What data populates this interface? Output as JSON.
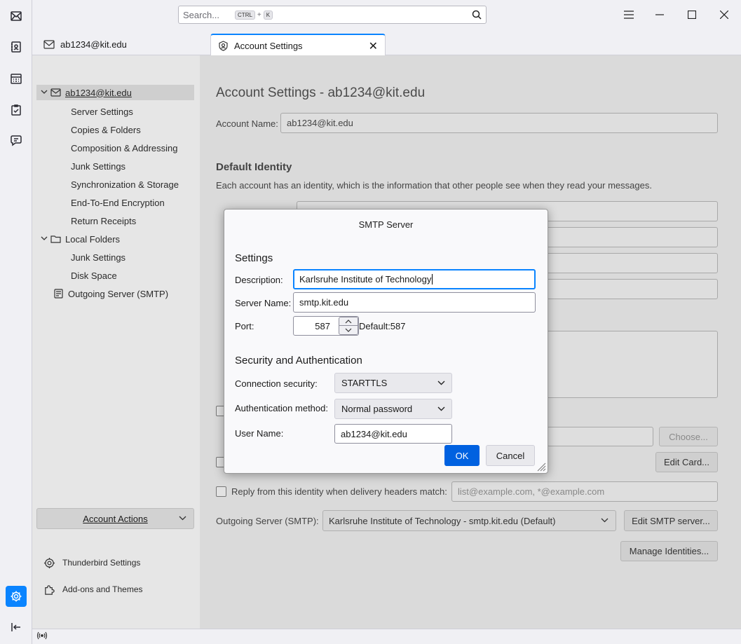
{
  "titlebar": {
    "search_placeholder": "Search...",
    "search_kbd1": "CTRL",
    "search_plus": "+",
    "search_kbd2": "K"
  },
  "tabs": [
    {
      "label": "ab1234@kit.edu"
    },
    {
      "label": "Account Settings"
    }
  ],
  "sidebar": {
    "account": "ab1234@kit.edu",
    "account_items": [
      "Server Settings",
      "Copies & Folders",
      "Composition & Addressing",
      "Junk Settings",
      "Synchronization & Storage",
      "End-To-End Encryption",
      "Return Receipts"
    ],
    "local_folders": "Local Folders",
    "local_items": [
      "Junk Settings",
      "Disk Space"
    ],
    "outgoing": "Outgoing Server (SMTP)",
    "account_actions": "Account Actions",
    "thunderbird_settings": "Thunderbird Settings",
    "addons": "Add-ons and Themes"
  },
  "main": {
    "title": "Account Settings - ab1234@kit.edu",
    "account_name_label": "Account Name:",
    "account_name_value": "ab1234@kit.edu",
    "default_identity": "Default Identity",
    "identity_desc": "Each account has an identity, which is the information that other people see when they read your messages.",
    "choose_btn": "Choose...",
    "edit_card_btn": "Edit Card...",
    "reply_from_label": "Reply from this identity when delivery headers match:",
    "reply_from_placeholder": "list@example.com, *@example.com",
    "outgoing_label": "Outgoing Server (SMTP):",
    "outgoing_value": "Karlsruhe Institute of Technology - smtp.kit.edu (Default)",
    "edit_smtp_btn": "Edit SMTP server...",
    "manage_identities_btn": "Manage Identities..."
  },
  "dialog": {
    "title": "SMTP Server",
    "settings_heading": "Settings",
    "description_label": "Description:",
    "description_value": "Karlsruhe Institute of Technology",
    "server_name_label": "Server Name:",
    "server_name_value": "smtp.kit.edu",
    "port_label": "Port:",
    "port_value": "587",
    "port_default": "Default:587",
    "security_heading": "Security and Authentication",
    "conn_security_label": "Connection security:",
    "conn_security_value": "STARTTLS",
    "auth_method_label": "Authentication method:",
    "auth_method_value": "Normal password",
    "username_label": "User Name:",
    "username_value": "ab1234@kit.edu",
    "ok": "OK",
    "cancel": "Cancel"
  },
  "colors": {
    "accent": "#0a84ff",
    "ok_button": "#0061e0"
  }
}
